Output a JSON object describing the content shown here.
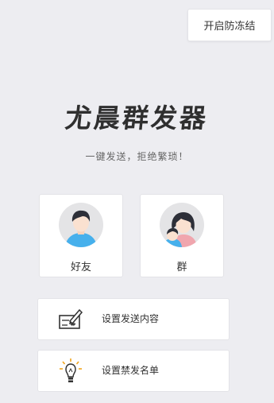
{
  "header": {
    "freeze_button_label": "开启防冻结"
  },
  "brand": {
    "logo_text": "尤晨群发器",
    "slogan": "一键发送，拒绝繁琐！"
  },
  "targets": [
    {
      "label": "好友",
      "icon": "user-avatar-icon"
    },
    {
      "label": "群",
      "icon": "group-avatar-icon"
    }
  ],
  "menu": [
    {
      "label": "设置发送内容",
      "icon": "cheque-pen-icon"
    },
    {
      "label": "设置禁发名单",
      "icon": "lightbulb-icon"
    }
  ],
  "colors": {
    "background": "#ededf1",
    "avatar_bg": "#e4e4e6",
    "shirt_blue": "#46b0ec",
    "hair_dark": "#2d2f38"
  }
}
